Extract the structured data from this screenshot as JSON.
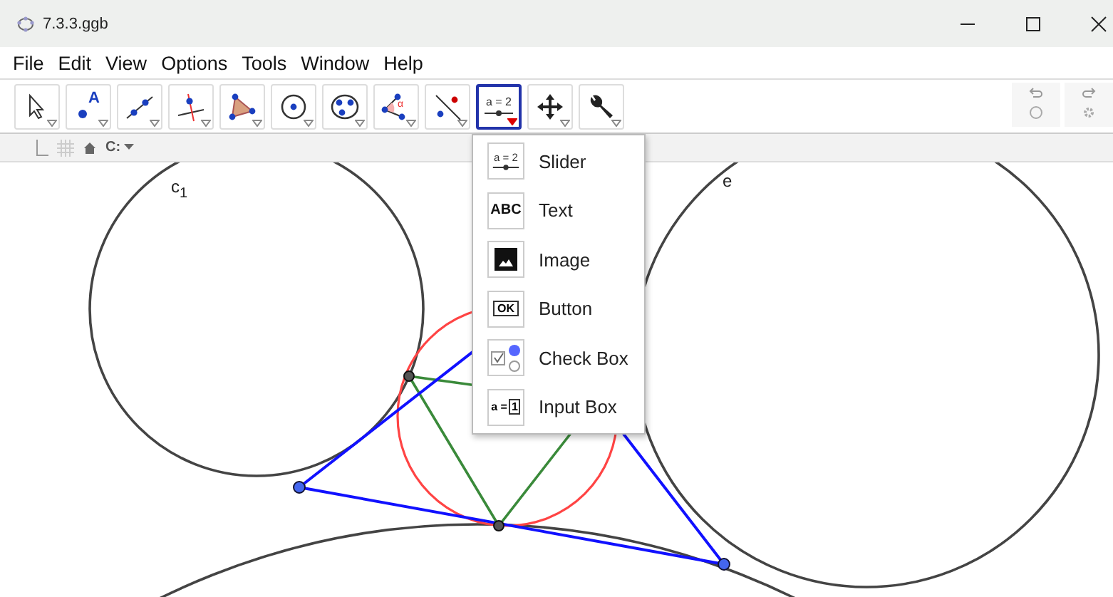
{
  "window": {
    "title": "7.3.3.ggb"
  },
  "menu_bar": [
    "File",
    "Edit",
    "View",
    "Options",
    "Tools",
    "Window",
    "Help"
  ],
  "toolbar": [
    {
      "kind": "move",
      "selected": false
    },
    {
      "kind": "point",
      "selected": false,
      "icon_text": "A"
    },
    {
      "kind": "line",
      "selected": false
    },
    {
      "kind": "perpendicular",
      "selected": false
    },
    {
      "kind": "polygon",
      "selected": false
    },
    {
      "kind": "circle",
      "selected": false
    },
    {
      "kind": "conic",
      "selected": false
    },
    {
      "kind": "angle",
      "selected": false,
      "icon_text": "α"
    },
    {
      "kind": "reflect",
      "selected": false
    },
    {
      "kind": "slider",
      "selected": true,
      "icon_text": "a = 2"
    },
    {
      "kind": "move-view",
      "selected": false
    },
    {
      "kind": "tools",
      "selected": false
    }
  ],
  "style_bar": {
    "input_label": "C:"
  },
  "tool_menu": [
    {
      "kind": "slider",
      "label": "Slider",
      "icon_text": "a = 2"
    },
    {
      "kind": "text",
      "label": "Text",
      "icon_text": "ABC"
    },
    {
      "kind": "image",
      "label": "Image"
    },
    {
      "kind": "button",
      "label": "Button",
      "icon_text": "OK"
    },
    {
      "kind": "checkbox",
      "label": "Check Box"
    },
    {
      "kind": "input",
      "label": "Input Box",
      "icon_text": "a =",
      "icon_value": "1"
    }
  ],
  "canvas": {
    "labels": [
      "c$_{1}$",
      "e"
    ]
  }
}
